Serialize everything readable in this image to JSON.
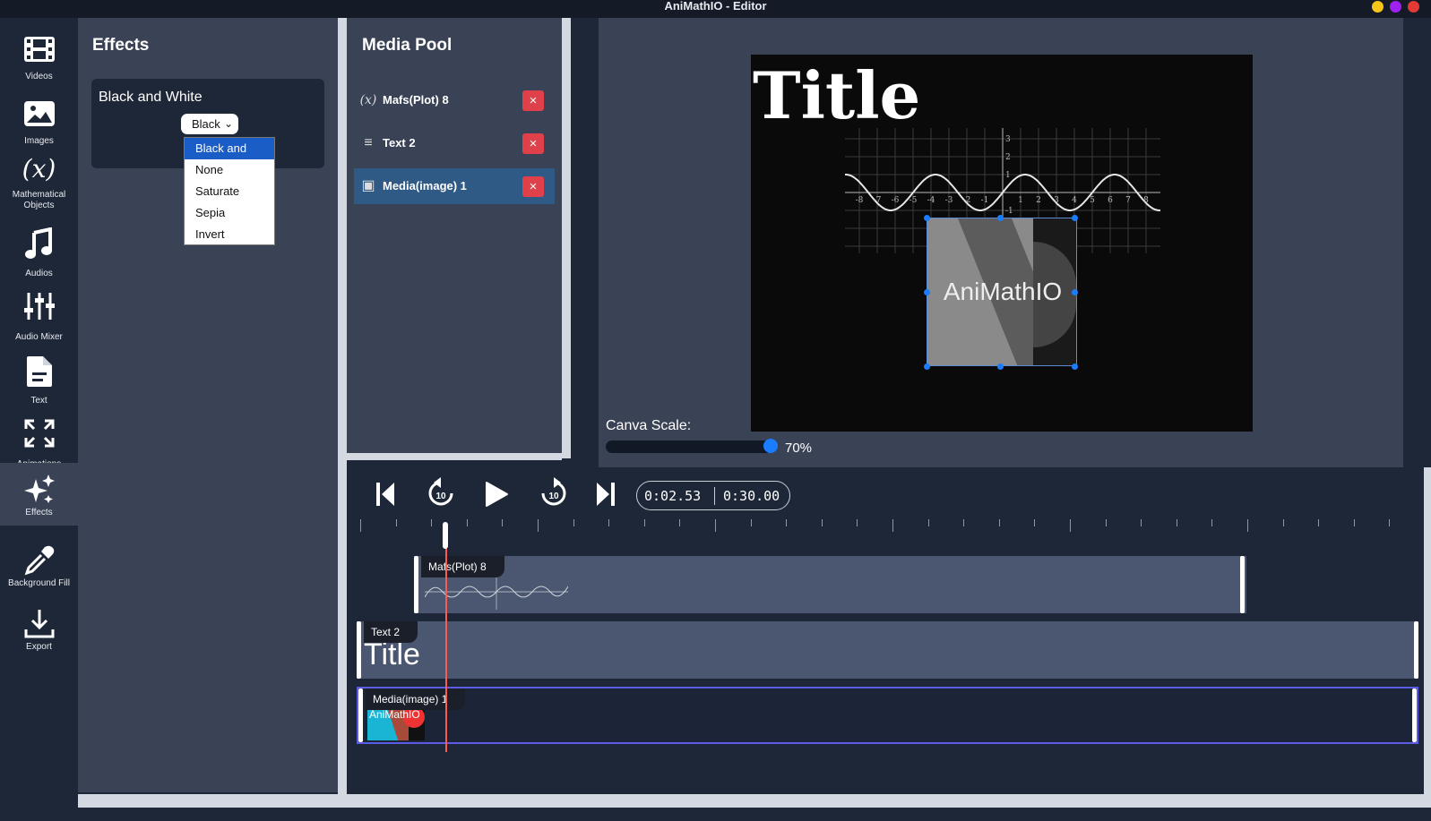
{
  "window": {
    "title": "AniMathIO - Editor",
    "buttons": [
      "#f5c518",
      "#a020f0",
      "#e53935"
    ]
  },
  "sidebar": {
    "items": [
      {
        "label": "Videos",
        "icon": "film-icon"
      },
      {
        "label": "Images",
        "icon": "image-icon"
      },
      {
        "label": "Mathematical Objects",
        "icon": "function-icon"
      },
      {
        "label": "Audios",
        "icon": "music-icon"
      },
      {
        "label": "Audio Mixer",
        "icon": "sliders-icon"
      },
      {
        "label": "Text",
        "icon": "document-icon"
      },
      {
        "label": "Animations",
        "icon": "expand-icon"
      },
      {
        "label": "Effects",
        "icon": "sparkles-icon",
        "active": true
      },
      {
        "label": "Background Fill",
        "icon": "eyedropper-icon"
      },
      {
        "label": "Export",
        "icon": "download-icon"
      }
    ]
  },
  "effects": {
    "heading": "Effects",
    "card_title": "Black and White",
    "select_value": "Black",
    "options": [
      "Black and White",
      "None",
      "Saturate",
      "Sepia",
      "Invert"
    ],
    "selected_option": "Black and White"
  },
  "media_pool": {
    "heading": "Media Pool",
    "items": [
      {
        "name": "Mafs(Plot) 8",
        "icon": "function-icon",
        "icon_glyph": "(x)",
        "delete": "×"
      },
      {
        "name": "Text 2",
        "icon": "text-lines-icon",
        "icon_glyph": "≡",
        "delete": "×"
      },
      {
        "name": "Media(image) 1",
        "icon": "image-icon",
        "icon_glyph": "▣",
        "delete": "×",
        "active": true
      }
    ]
  },
  "preview": {
    "canvas_title": "Title",
    "logo_text": "AniMathIO",
    "plot_x_ticks": [
      "-8",
      "-7",
      "-6",
      "-5",
      "-4",
      "-3",
      "-2",
      "-1",
      "1",
      "2",
      "3",
      "4",
      "5",
      "6",
      "7",
      "8"
    ],
    "plot_y_ticks": [
      "3",
      "2",
      "1",
      "-1"
    ],
    "scale_label": "Canva Scale:",
    "scale_value": "70%",
    "scale_fraction": 0.7
  },
  "timeline": {
    "current_time": "0:02.53",
    "total_time": "0:30.00",
    "controls": [
      "skip-to-start-icon",
      "rewind-10-icon",
      "play-icon",
      "forward-10-icon",
      "skip-to-end-icon"
    ],
    "rewind_label": "10",
    "forward_label": "10",
    "tracks": [
      {
        "name": "Mafs(Plot) 8"
      },
      {
        "name": "Text 2",
        "preview_text": "Title"
      },
      {
        "name": "Media(image) 1",
        "preview_text": "AniMathIO"
      }
    ]
  }
}
